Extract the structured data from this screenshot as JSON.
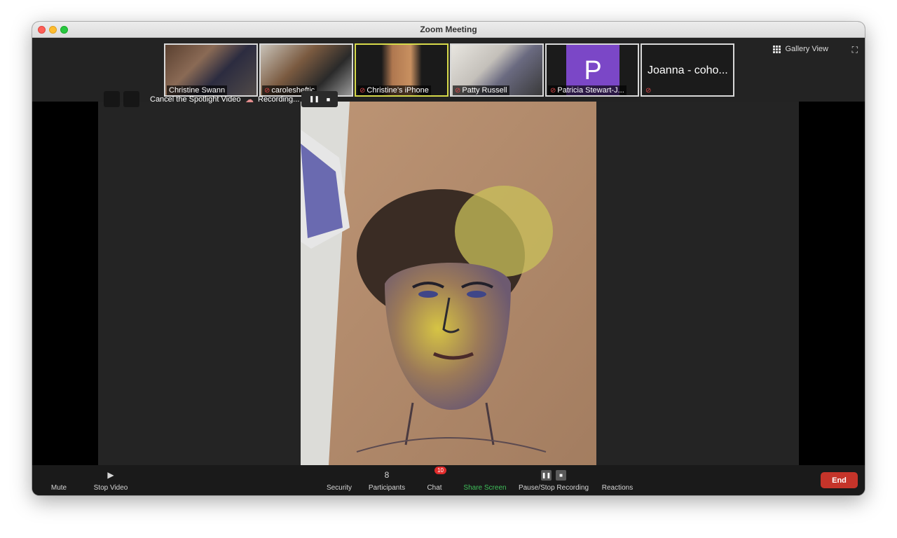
{
  "window": {
    "title": "Zoom Meeting"
  },
  "participants_strip": [
    {
      "name": "Christine Swann",
      "muted": false
    },
    {
      "name": "carolesheftiс",
      "muted": true
    },
    {
      "name": "Christine’s iPhone",
      "muted": true,
      "active": true
    },
    {
      "name": "Patty Russell",
      "muted": true
    },
    {
      "name": "Patricia Stewart-J...",
      "muted": true,
      "avatar_letter": "P"
    },
    {
      "name": "Joanna - coho...",
      "muted": true
    }
  ],
  "view": {
    "gallery_label": "Gallery View"
  },
  "spotlight": {
    "cancel_label": "Cancel the Spotlight Video",
    "recording_label": "Recording..."
  },
  "toolbar": {
    "mute": "Mute",
    "stop_video": "Stop Video",
    "security": "Security",
    "participants": "Participants",
    "participants_count": "8",
    "chat": "Chat",
    "chat_badge": "10",
    "share_screen": "Share Screen",
    "pause_stop_recording": "Pause/Stop Recording",
    "reactions": "Reactions",
    "end": "End"
  },
  "colors": {
    "share_green": "#3fbf5a",
    "end_red": "#c5342a",
    "avatar_purple": "#7b47c7",
    "active_tile": "#d6d94a"
  }
}
